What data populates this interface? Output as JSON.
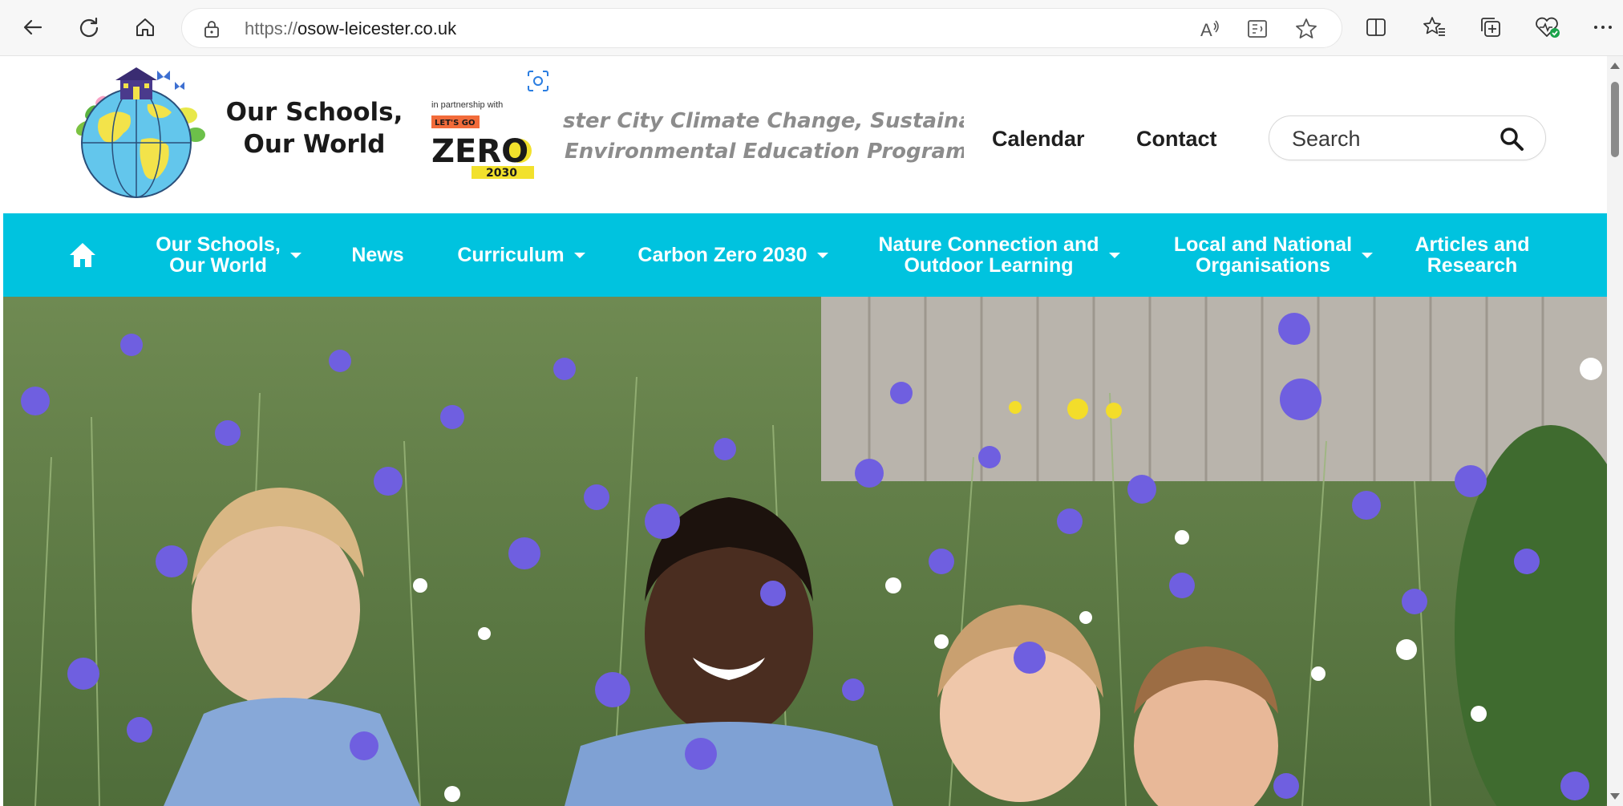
{
  "browser": {
    "url_prefix": "https://",
    "url_host": "osow-leicester.co.uk",
    "icons": [
      "back-arrow-icon",
      "refresh-icon",
      "home-icon",
      "lock-icon",
      "read-aloud-icon",
      "immersive-reader-icon",
      "favorite-star-icon",
      "split-screen-icon",
      "favorites-icon",
      "collections-icon",
      "browser-essentials-icon",
      "more-menu-icon"
    ]
  },
  "header": {
    "brand_line1": "Our Schools,",
    "brand_line2": "Our World",
    "partner_text": "in partnership with",
    "zero_logo_top": "LET'S GO",
    "zero_logo_word": "ZERO",
    "zero_logo_year": "2030",
    "tagline_line1": "ster City Climate Change, Sustainability",
    "tagline_line2": "Environmental Education Programme",
    "calendar_label": "Calendar",
    "contact_label": "Contact",
    "search_placeholder": "Search"
  },
  "nav": {
    "accent_color": "#00c3df",
    "items": [
      {
        "line1": "Our Schools,",
        "line2": "Our World",
        "dropdown": true
      },
      {
        "line1": "News",
        "line2": "",
        "dropdown": false
      },
      {
        "line1": "Curriculum",
        "line2": "",
        "dropdown": true
      },
      {
        "line1": "Carbon Zero 2030",
        "line2": "",
        "dropdown": true
      },
      {
        "line1": "Nature Connection and",
        "line2": "Outdoor Learning",
        "dropdown": true
      },
      {
        "line1": "Local and National",
        "line2": "Organisations",
        "dropdown": true
      },
      {
        "line1": "Articles and",
        "line2": "Research",
        "dropdown": false
      }
    ]
  }
}
